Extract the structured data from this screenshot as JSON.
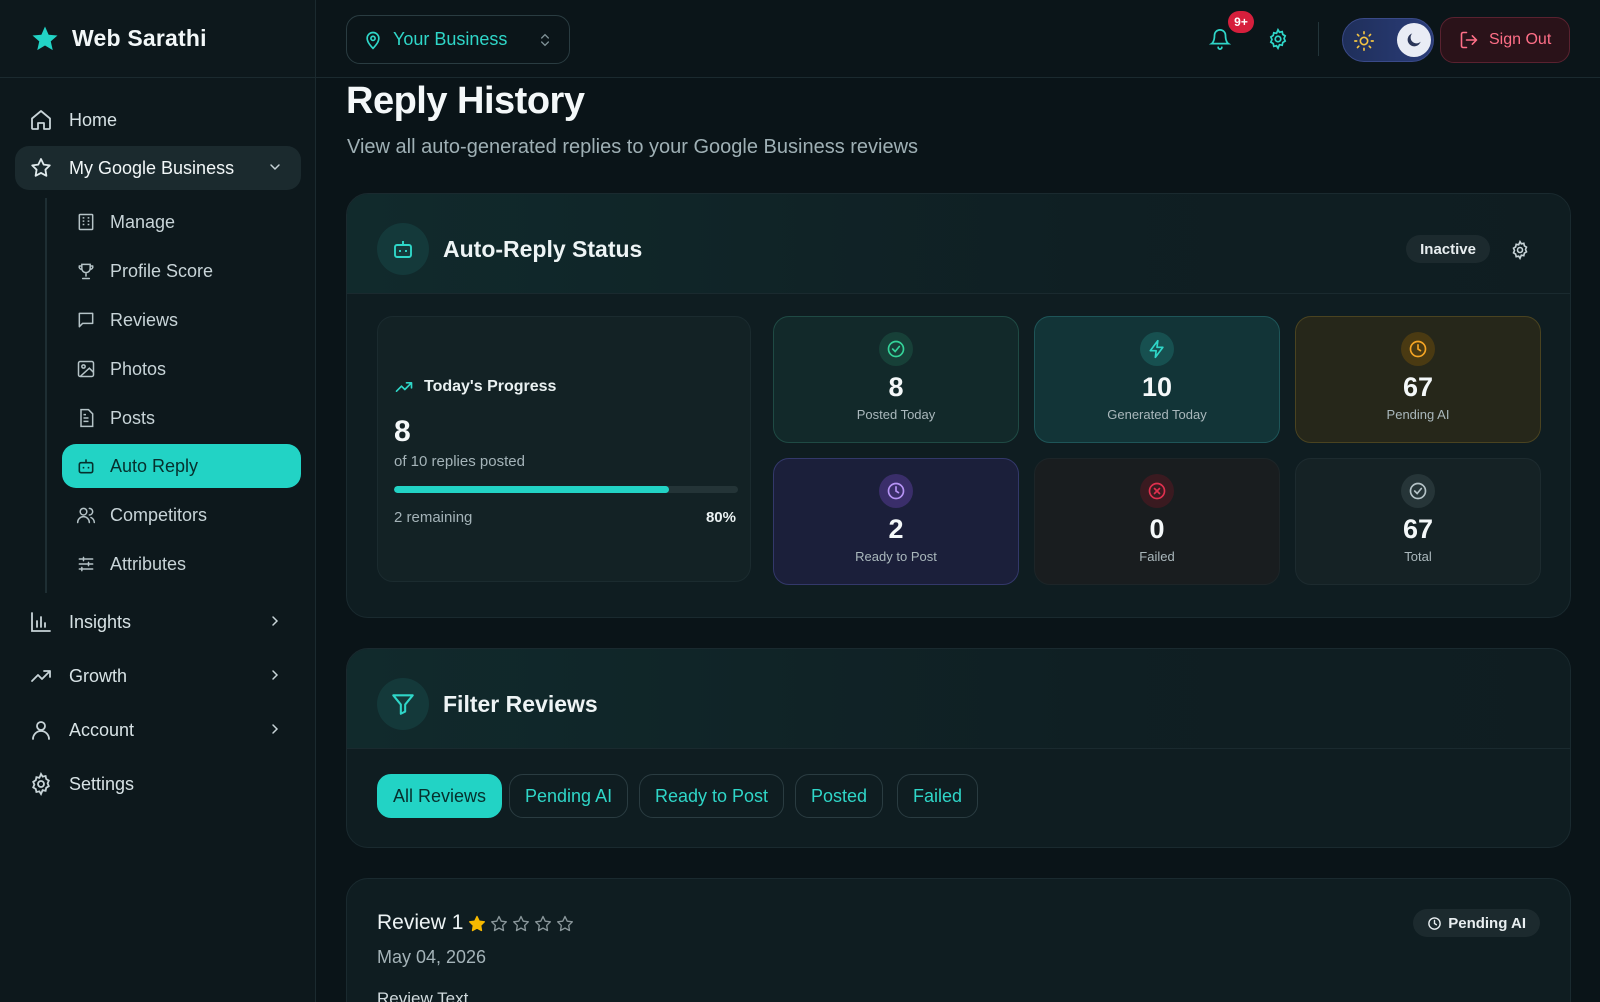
{
  "app": {
    "name": "Web Sarathi"
  },
  "sidebar": {
    "items": [
      {
        "label": "Home"
      },
      {
        "label": "My Google Business"
      },
      {
        "label": "Insights"
      },
      {
        "label": "Growth"
      },
      {
        "label": "Account"
      },
      {
        "label": "Settings"
      }
    ],
    "sub_items": [
      {
        "label": "Manage"
      },
      {
        "label": "Profile Score"
      },
      {
        "label": "Reviews"
      },
      {
        "label": "Photos"
      },
      {
        "label": "Posts"
      },
      {
        "label": "Auto Reply"
      },
      {
        "label": "Competitors"
      },
      {
        "label": "Attributes"
      }
    ],
    "active_sub": "Auto Reply"
  },
  "topbar": {
    "business": "Your Business",
    "notifications_badge": "9+",
    "sign_out": "Sign Out"
  },
  "page": {
    "title": "Reply History",
    "subtitle": "View all auto-generated replies to your Google Business reviews"
  },
  "auto_reply": {
    "title": "Auto-Reply Status",
    "status": "Inactive",
    "progress": {
      "title": "Today's Progress",
      "posted": "8",
      "of_text": "of 10 replies posted",
      "remaining": "2 remaining",
      "percent": "80%",
      "fraction": 0.8
    },
    "stats": [
      {
        "value": "8",
        "label": "Posted Today",
        "icon": "check-circle-icon"
      },
      {
        "value": "10",
        "label": "Generated Today",
        "icon": "lightning-icon"
      },
      {
        "value": "67",
        "label": "Pending AI",
        "icon": "clock-icon"
      },
      {
        "value": "2",
        "label": "Ready to Post",
        "icon": "clock-icon"
      },
      {
        "value": "0",
        "label": "Failed",
        "icon": "x-circle-icon"
      },
      {
        "value": "67",
        "label": "Total",
        "icon": "check-circle-icon"
      }
    ]
  },
  "filter": {
    "title": "Filter Reviews",
    "options": [
      "All Reviews",
      "Pending AI",
      "Ready to Post",
      "Posted",
      "Failed"
    ],
    "selected": "All Reviews"
  },
  "review": {
    "title": "Review 1",
    "rating": 1,
    "max_rating": 5,
    "date": "May 04, 2026",
    "text_label": "Review Text",
    "status": "Pending AI"
  },
  "colors": {
    "accent": "#22d3c5",
    "background": "#0a1418",
    "danger": "#ff6f87",
    "star": "#f5b800"
  }
}
